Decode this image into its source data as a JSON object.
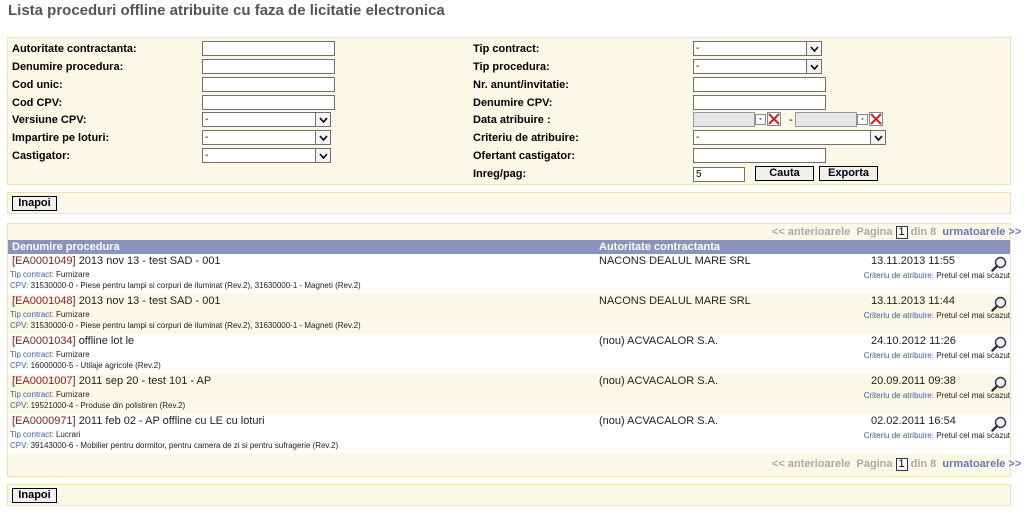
{
  "page": {
    "title": "Lista proceduri offline atribuite cu faza de licitatie electronica"
  },
  "filters": {
    "left": [
      {
        "label": "Autoritate contractanta:",
        "type": "text",
        "value": ""
      },
      {
        "label": "Denumire procedura:",
        "type": "text",
        "value": ""
      },
      {
        "label": "Cod unic:",
        "type": "text",
        "value": ""
      },
      {
        "label": "Cod CPV:",
        "type": "text",
        "value": ""
      },
      {
        "label": "Versiune CPV:",
        "type": "select",
        "value": "-"
      },
      {
        "label": "Impartire pe loturi:",
        "type": "select",
        "value": "-"
      },
      {
        "label": "Castigator:",
        "type": "select",
        "value": "-"
      }
    ],
    "right": [
      {
        "label": "Tip contract:",
        "type": "select",
        "value": "-"
      },
      {
        "label": "Tip procedura:",
        "type": "select",
        "value": "-"
      },
      {
        "label": "Nr. anunt/invitatie:",
        "type": "text",
        "value": ""
      },
      {
        "label": "Denumire CPV:",
        "type": "text",
        "value": ""
      },
      {
        "label": "Data atribuire :",
        "type": "daterange",
        "separator": "-"
      },
      {
        "label": "Criteriu de atribuire:",
        "type": "select",
        "value": "-"
      },
      {
        "label": "Ofertant castigator:",
        "type": "text",
        "value": ""
      },
      {
        "label": "Inreg/pag:",
        "type": "text",
        "value": "5"
      }
    ],
    "search_label": "Cauta",
    "export_label": "Exporta"
  },
  "back_label": "Inapoi",
  "pager": {
    "prev": "<< anterioarele",
    "page_label": "Pagina",
    "page": "1",
    "of": "din 8",
    "next": "urmatoarele >>"
  },
  "table": {
    "col1": "Denumire procedura",
    "col2": "Autoritate contractanta",
    "tip_label": "Tip contract:",
    "cpv_label": "CPV:",
    "crit_label": "Criteriu de atribuire:",
    "rows": [
      {
        "code": "[EA0001049]",
        "name": "2013 nov 13 - test SAD - 001",
        "authority": "NACONS DEALUL MARE SRL",
        "date": "13.11.2013 11:55",
        "tip": "Furnizare",
        "cpv": "31530000-0 - Piese pentru lampi si corpuri de iluminat (Rev.2), 31630000-1 - Magneti (Rev.2)",
        "criteriu": "Pretul cel mai scazut"
      },
      {
        "code": "[EA0001048]",
        "name": "2013 nov 13 - test SAD - 001",
        "authority": "NACONS DEALUL MARE SRL",
        "date": "13.11.2013 11:44",
        "tip": "Furnizare",
        "cpv": "31530000-0 - Piese pentru lampi si corpuri de iluminat (Rev.2), 31630000-1 - Magneti (Rev.2)",
        "criteriu": "Pretul cel mai scazut"
      },
      {
        "code": "[EA0001034]",
        "name": "offline lot le",
        "authority": "(nou) ACVACALOR S.A.",
        "date": "24.10.2012 11:26",
        "tip": "Furnizare",
        "cpv": "16000000-5 - Utilaje agricole (Rev.2)",
        "criteriu": "Pretul cel mai scazut"
      },
      {
        "code": "[EA0001007]",
        "name": "2011 sep 20 - test 101 - AP",
        "authority": "(nou) ACVACALOR S.A.",
        "date": "20.09.2011 09:38",
        "tip": "Furnizare",
        "cpv": "19521000-4 - Produse din polistiren (Rev.2)",
        "criteriu": "Pretul cel mai scazut"
      },
      {
        "code": "[EA0000971]",
        "name": "2011 feb 02 - AP offline cu LE cu loturi",
        "authority": "(nou) ACVACALOR S.A.",
        "date": "02.02.2011 16:54",
        "tip": "Lucrari",
        "cpv": "39143000-6 - Mobilier pentru dormitor, pentru camera de zi si pentru sufragerie (Rev.2)",
        "criteriu": "Pretul cel mai scazut"
      }
    ]
  }
}
